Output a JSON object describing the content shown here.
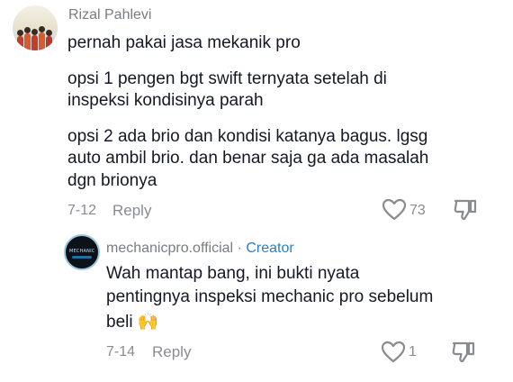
{
  "comment": {
    "username": "Rizal Pahlevi",
    "paragraphs": [
      "pernah pakai jasa mekanik pro",
      "opsi 1 pengen bgt swift ternyata setelah di",
      "inspeksi kondisinya parah",
      "opsi 2 ada brio dan kondisi katanya bagus. lgsg",
      "auto ambil brio. dan benar saja ga ada masalah",
      "dgn brionya"
    ],
    "date": "7-12",
    "reply_label": "Reply",
    "like_count": "73",
    "like_icon": "heart-outline-icon",
    "dislike_icon": "thumbs-down-icon"
  },
  "reply": {
    "username": "mechanicpro.official",
    "separator": "·",
    "badge": "Creator",
    "lines": [
      "Wah mantap bang, ini bukti nyata",
      "pentingnya inspeksi mechanic pro sebelum",
      "beli"
    ],
    "emoji": "🙌",
    "date": "7-14",
    "reply_label": "Reply",
    "like_count": "1"
  },
  "colors": {
    "text": "#161823",
    "muted": "#8a8b91",
    "creator": "#2a7fc5"
  }
}
